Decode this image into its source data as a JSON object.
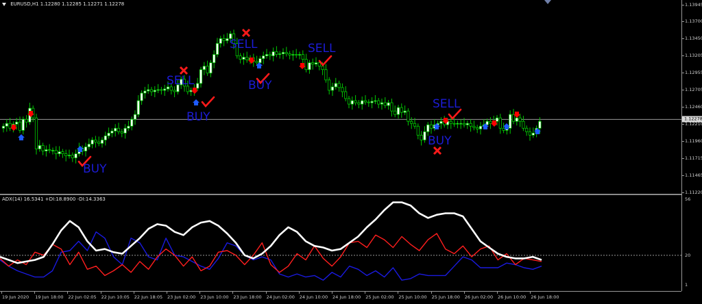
{
  "chart_header": {
    "symbol": "EURUSD,H1",
    "ohlc": "1.12280 1.12285 1.12271 1.12278"
  },
  "indicator_header": {
    "text": "ADX(14) 16.5341 +DI:18.8900 -DI:14.3363"
  },
  "price_axis": {
    "labels": [
      "1.13945",
      "1.13700",
      "1.13450",
      "1.13205",
      "1.12955",
      "1.12705",
      "1.12460",
      "1.12278",
      "1.12210",
      "1.11960",
      "1.11715",
      "1.11465",
      "1.11220"
    ],
    "current_price": "1.12278"
  },
  "adx_axis": {
    "labels": [
      "56",
      "20",
      "1"
    ]
  },
  "time_axis": {
    "labels": [
      "19 Jun 2020",
      "19 Jun 18:00",
      "22 Jun 02:05",
      "22 Jun 10:05",
      "22 Jun 18:05",
      "23 Jun 02:00",
      "23 Jun 10:00",
      "23 Jun 18:00",
      "24 Jun 02:00",
      "24 Jun 10:00",
      "24 Jun 18:00",
      "25 Jun 02:00",
      "25 Jun 10:00",
      "25 Jun 18:00",
      "26 Jun 02:00",
      "26 Jun 10:00",
      "26 Jun 18:00"
    ]
  },
  "signals": [
    {
      "label": "BUY",
      "kind": "buy"
    },
    {
      "label": "SELL",
      "kind": "sell"
    },
    {
      "label": "BUY",
      "kind": "buy"
    },
    {
      "label": "SELL",
      "kind": "sell"
    },
    {
      "label": "BUY",
      "kind": "buy"
    },
    {
      "label": "SELL",
      "kind": "sell"
    },
    {
      "label": "SELL",
      "kind": "sell"
    },
    {
      "label": "BUY",
      "kind": "buy"
    }
  ],
  "colors": {
    "background": "#000000",
    "candle_bull": "#ffffff",
    "candle_bear": "#000000",
    "wick": "#00cc00",
    "signal_text": "#1c1cd6",
    "arrow_sell": "#ff0000",
    "arrow_buy": "#1e5bff",
    "check": "#ff1a1a",
    "cross": "#ff1a1a",
    "adx_line": "#ffffff",
    "plus_di": "#ff1e1e",
    "minus_di": "#1a1ae0",
    "level_line": "#9a9a9a"
  },
  "chart_data": [
    {
      "type": "candlestick",
      "title": "EURUSD,H1",
      "ylim": [
        1.1122,
        1.1395
      ],
      "current_price": 1.12278,
      "closes": [
        1.1218,
        1.1222,
        1.1215,
        1.1221,
        1.1224,
        1.1212,
        1.1228,
        1.1224,
        1.1244,
        1.123,
        1.1185,
        1.119,
        1.1182,
        1.1184,
        1.1183,
        1.1183,
        1.1178,
        1.1181,
        1.1178,
        1.1175,
        1.1176,
        1.1172,
        1.1178,
        1.1186,
        1.1182,
        1.1188,
        1.1192,
        1.1198,
        1.1195,
        1.1193,
        1.1198,
        1.1204,
        1.1208,
        1.1211,
        1.1215,
        1.121,
        1.1208,
        1.1215,
        1.1218,
        1.1228,
        1.1235,
        1.1255,
        1.1266,
        1.1269,
        1.1271,
        1.1268,
        1.127,
        1.1271,
        1.127,
        1.1272,
        1.1275,
        1.127,
        1.1268,
        1.1278,
        1.1286,
        1.1276,
        1.1268,
        1.127,
        1.1273,
        1.128,
        1.13,
        1.1305,
        1.1295,
        1.131,
        1.1322,
        1.1338,
        1.1345,
        1.1342,
        1.1345,
        1.1352,
        1.1338,
        1.132,
        1.1315,
        1.1318,
        1.1314,
        1.1317,
        1.1312,
        1.131,
        1.1316,
        1.132,
        1.1322,
        1.132,
        1.1326,
        1.1322,
        1.1323,
        1.1325,
        1.1323,
        1.1321,
        1.1322,
        1.1321,
        1.1322,
        1.1315,
        1.13,
        1.131,
        1.1308,
        1.131,
        1.1305,
        1.13,
        1.1285,
        1.127,
        1.1275,
        1.128,
        1.1274,
        1.1268,
        1.1258,
        1.125,
        1.1255,
        1.1252,
        1.125,
        1.1255,
        1.1253,
        1.1252,
        1.1254,
        1.1255,
        1.125,
        1.1252,
        1.1248,
        1.1252,
        1.124,
        1.1235,
        1.1245,
        1.1238,
        1.124,
        1.1225,
        1.1222,
        1.1218,
        1.1205,
        1.1198,
        1.121,
        1.122,
        1.1215,
        1.122,
        1.1222,
        1.1225,
        1.122,
        1.1225,
        1.1222,
        1.1221,
        1.1222,
        1.1222,
        1.122,
        1.1222,
        1.1218,
        1.1216,
        1.1214,
        1.1218,
        1.122,
        1.1225,
        1.1222,
        1.1225,
        1.123,
        1.1215,
        1.1212,
        1.1215,
        1.1235,
        1.1225,
        1.123,
        1.1225,
        1.1215,
        1.121,
        1.1205,
        1.1208,
        1.1215,
        1.1225
      ]
    },
    {
      "type": "line",
      "title": "ADX(14) 16.5341 +DI:18.8900 -DI:14.3363",
      "ylim": [
        1,
        56
      ],
      "levels": [
        20
      ],
      "series": [
        {
          "name": "ADX(14)",
          "values": [
            19,
            17,
            15,
            16,
            17,
            19,
            27,
            36,
            42,
            38,
            29,
            23,
            24,
            22,
            21,
            26,
            31,
            37,
            40,
            39,
            35,
            33,
            38,
            41,
            42,
            39,
            34,
            28,
            20,
            18,
            21,
            26,
            33,
            38,
            35,
            29,
            26,
            25,
            23,
            24,
            28,
            32,
            38,
            43,
            49,
            54,
            54,
            52,
            47,
            44,
            46,
            47,
            47,
            45,
            37,
            29,
            25,
            21,
            19,
            18,
            18,
            19,
            17
          ]
        },
        {
          "name": "+DI",
          "values": [
            18,
            13,
            17,
            14,
            22,
            20,
            27,
            24,
            14,
            22,
            11,
            13,
            7,
            10,
            14,
            9,
            16,
            11,
            19,
            24,
            20,
            13,
            19,
            10,
            13,
            22,
            23,
            20,
            14,
            20,
            28,
            14,
            9,
            13,
            21,
            17,
            26,
            18,
            13,
            19,
            28,
            29,
            25,
            33,
            30,
            25,
            32,
            27,
            23,
            30,
            34,
            24,
            21,
            26,
            19,
            24,
            26,
            17,
            21,
            14,
            18,
            17,
            16
          ]
        },
        {
          "name": "-DI",
          "values": [
            17,
            13,
            10,
            8,
            6,
            6,
            10,
            22,
            23,
            29,
            23,
            35,
            31,
            19,
            14,
            31,
            28,
            19,
            17,
            31,
            20,
            19,
            16,
            13,
            11,
            18,
            28,
            26,
            20,
            17,
            19,
            17,
            8,
            6,
            8,
            6,
            7,
            4,
            9,
            6,
            13,
            11,
            7,
            10,
            6,
            12,
            4,
            5,
            8,
            7,
            7,
            7,
            13,
            19,
            17,
            12,
            12,
            12,
            15,
            14,
            12,
            11,
            13
          ]
        }
      ]
    }
  ]
}
